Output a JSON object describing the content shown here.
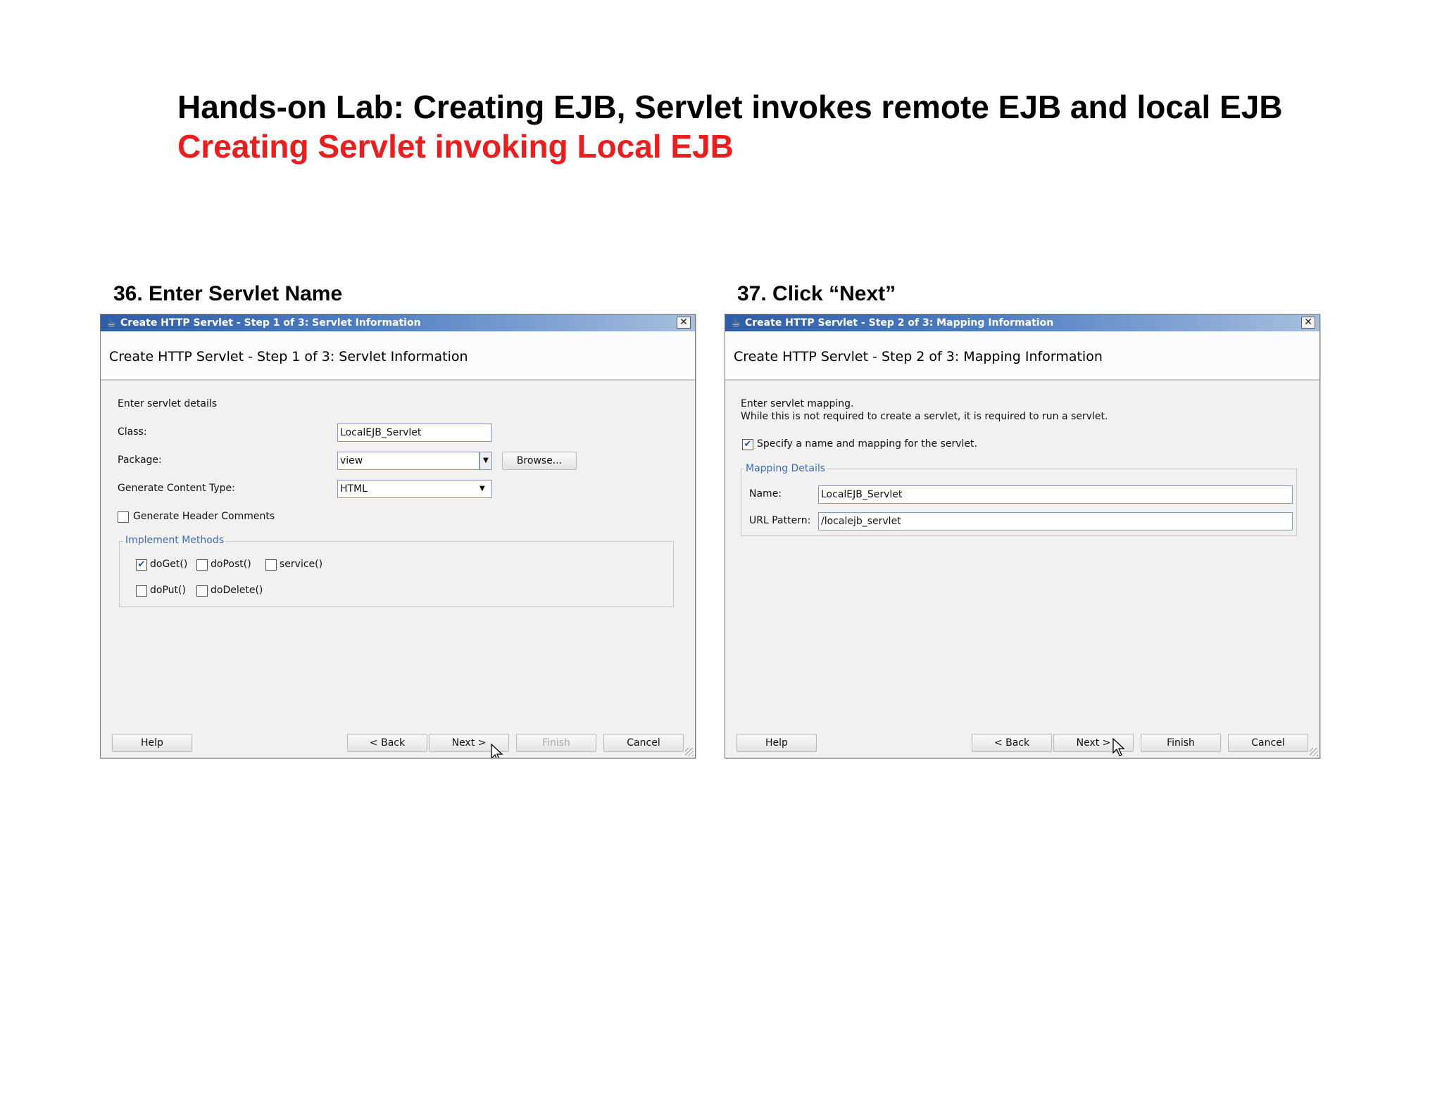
{
  "page": {
    "title": "Hands-on Lab: Creating EJB, Servlet invokes remote EJB and local EJB",
    "subtitle": "Creating Servlet invoking Local EJB"
  },
  "step1": {
    "caption": "36. Enter Servlet Name",
    "window_title": "Create HTTP Servlet - Step 1 of 3: Servlet Information",
    "header": "Create HTTP Servlet - Step 1 of 3: Servlet Information",
    "intro": "Enter servlet details",
    "class_label": "Class:",
    "class_value": "LocalEJB_Servlet",
    "package_label": "Package:",
    "package_value": "view",
    "browse_label": "Browse...",
    "content_type_label": "Generate Content Type:",
    "content_type_value": "HTML",
    "header_comments_label": "Generate Header Comments",
    "header_comments_checked": false,
    "group_title": "Implement Methods",
    "methods": [
      {
        "label": "doGet()",
        "checked": true
      },
      {
        "label": "doPost()",
        "checked": false
      },
      {
        "label": "service()",
        "checked": false
      },
      {
        "label": "doPut()",
        "checked": false
      },
      {
        "label": "doDelete()",
        "checked": false
      }
    ],
    "buttons": {
      "help": "Help",
      "back": "< Back",
      "next": "Next >",
      "finish": "Finish",
      "cancel": "Cancel"
    }
  },
  "step2": {
    "caption": "37. Click “Next”",
    "window_title": "Create HTTP Servlet - Step 2 of 3: Mapping Information",
    "header": "Create HTTP Servlet - Step 2 of 3: Mapping Information",
    "intro_line1": "Enter servlet mapping.",
    "intro_line2": "While this is not required to create a servlet, it is required to run a servlet.",
    "specify_label": "Specify a name and mapping for the servlet.",
    "specify_checked": true,
    "group_title": "Mapping Details",
    "name_label": "Name:",
    "name_value": "LocalEJB_Servlet",
    "url_label": "URL Pattern:",
    "url_value": "/localejb_servlet",
    "buttons": {
      "help": "Help",
      "back": "< Back",
      "next": "Next >",
      "finish": "Finish",
      "cancel": "Cancel"
    }
  },
  "icons": {
    "app": "java-cup-icon",
    "close": "close-icon",
    "checkmark": "✔",
    "dropdown": "▼"
  },
  "colors": {
    "subtitle": "#ee1c1c",
    "titlebar": "#2f5ea8",
    "group_title": "#3a6bc0"
  }
}
